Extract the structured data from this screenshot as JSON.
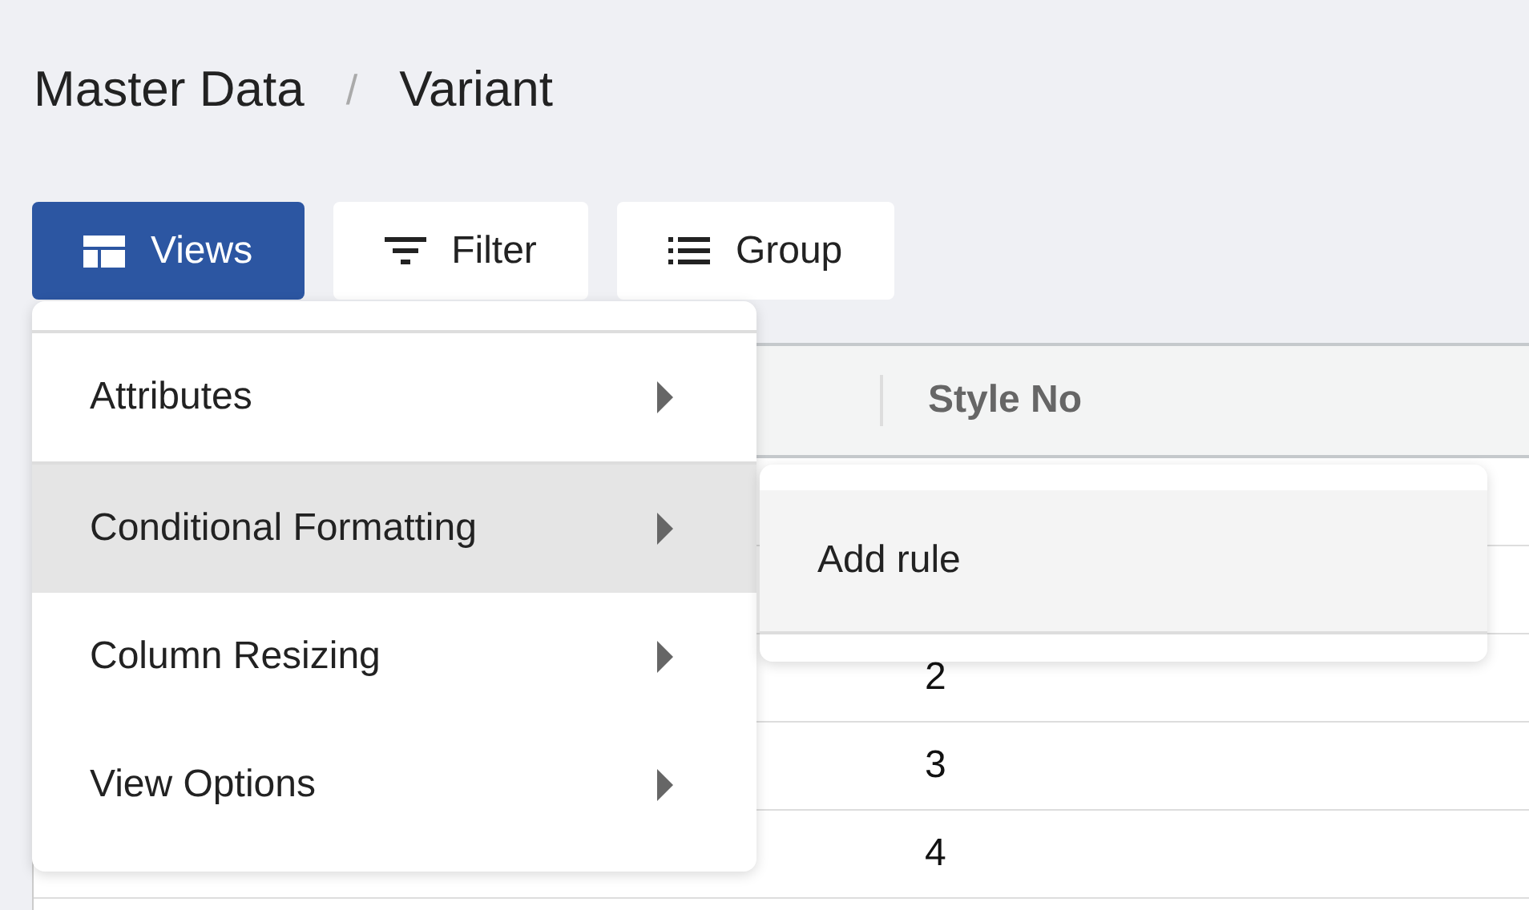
{
  "breadcrumb": {
    "items": [
      "Master Data",
      "Variant"
    ],
    "separator": "/"
  },
  "toolbar": [
    {
      "label": "Views",
      "kind": "views",
      "selected": true
    },
    {
      "label": "Filter",
      "kind": "filter",
      "selected": false
    },
    {
      "label": "Group",
      "kind": "group",
      "selected": false
    }
  ],
  "table": {
    "columns": [
      "Style No"
    ],
    "rows": [
      {
        "style_no": "2"
      },
      {
        "style_no": "3"
      },
      {
        "style_no": "4"
      }
    ]
  },
  "views_menu": {
    "items": [
      {
        "label": "Attributes",
        "selected": false
      },
      {
        "label": "Conditional Formatting",
        "selected": true
      },
      {
        "label": "Column Resizing",
        "selected": false
      },
      {
        "label": "View Options",
        "selected": false
      }
    ]
  },
  "submenu": {
    "items": [
      "Add rule"
    ]
  }
}
